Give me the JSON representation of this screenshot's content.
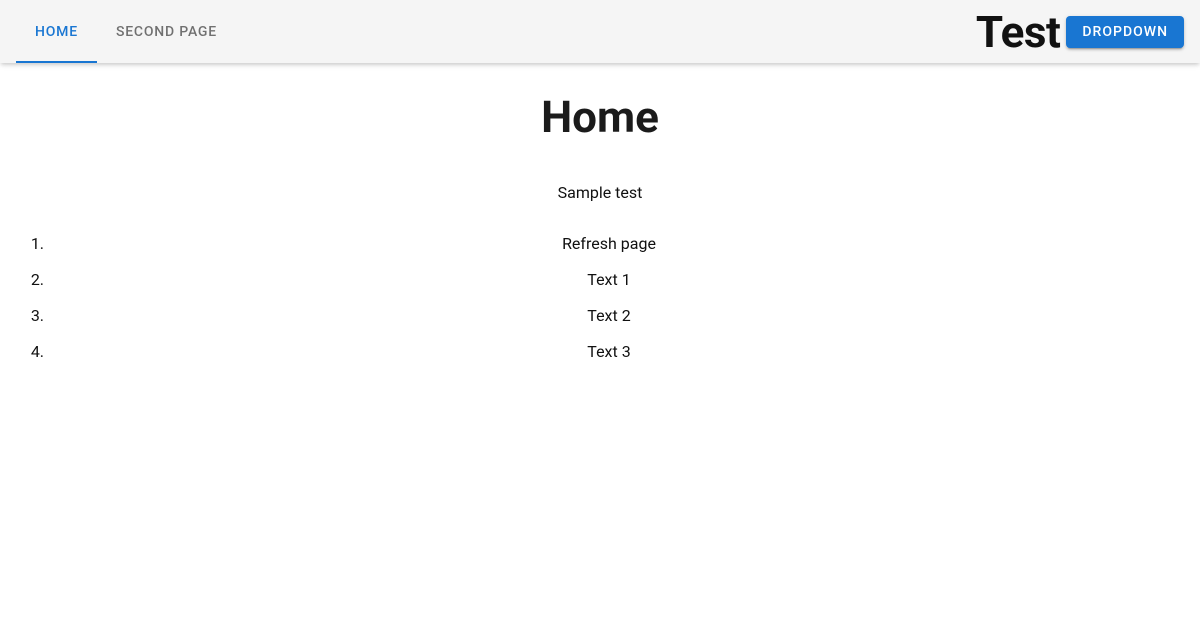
{
  "appbar": {
    "tabs": [
      {
        "label": "Home",
        "active": true
      },
      {
        "label": "Second Page",
        "active": false
      }
    ],
    "brand": "Test",
    "dropdown_label": "Dropdown"
  },
  "main": {
    "title": "Home",
    "subtitle": "Sample test",
    "items": [
      "Refresh page",
      "Text 1",
      "Text 2",
      "Text 3"
    ]
  }
}
